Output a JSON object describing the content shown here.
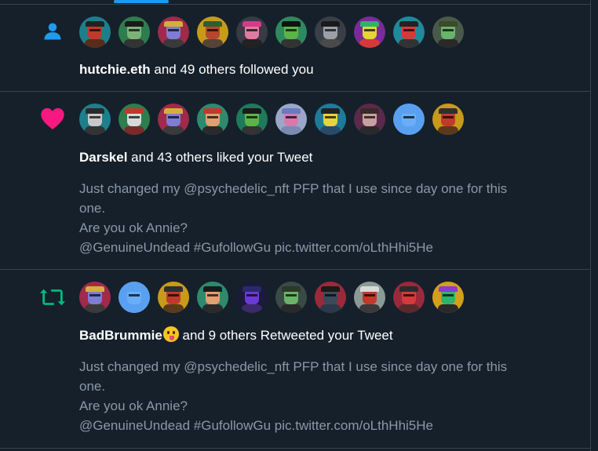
{
  "colors": {
    "background": "#15202b",
    "border": "#38444d",
    "accent_blue": "#1d9bf0",
    "like_pink": "#f91880",
    "retweet_green": "#00ba7c",
    "secondary_text": "#8b98a5"
  },
  "notifications": [
    {
      "type": "follow",
      "icon": "user-icon",
      "actor": "hutchie.eth",
      "rest": " and 49 others followed you",
      "avatars": [
        {
          "bg": "#1e7f8c",
          "skin": "#c0392b",
          "hat": "#222222",
          "body": "#5a2a1a"
        },
        {
          "bg": "#2e7d4f",
          "skin": "#7db37a",
          "hat": "#1a1a1a",
          "body": "#333333"
        },
        {
          "bg": "#a02a4a",
          "skin": "#7d7dd6",
          "hat": "#d4b03a",
          "body": "#3a3a3a"
        },
        {
          "bg": "#c89a1a",
          "skin": "#b5472f",
          "hat": "#2f5d2f",
          "body": "#554433"
        },
        {
          "bg": "#3a3a44",
          "skin": "#e07aa0",
          "hat": "#d63a8a",
          "body": "#222222"
        },
        {
          "bg": "#2e8a5e",
          "skin": "#5db34a",
          "hat": "#111111",
          "body": "#333333"
        },
        {
          "bg": "#3a3f47",
          "skin": "#9aa0a6",
          "hat": "#1a1a1a",
          "body": "#4a4a4a"
        },
        {
          "bg": "#7a2a9a",
          "skin": "#e6d43a",
          "hat": "#2fb36a",
          "body": "#d43a3a"
        },
        {
          "bg": "#1e8a9a",
          "skin": "#d43a3a",
          "hat": "#222222",
          "body": "#333333"
        },
        {
          "bg": "#4a5a4a",
          "skin": "#6ab36a",
          "hat": "#3a4a2a",
          "body": "#2a2a2a"
        }
      ]
    },
    {
      "type": "like",
      "icon": "heart-icon",
      "actor": "Darskel",
      "rest": " and 43 others liked your Tweet",
      "text_lines": [
        "Just changed my @psychedelic_nft PFP that I use since day one for this",
        "one.",
        "Are you ok Annie?",
        "@GenuineUndead #GufollowGu pic.twitter.com/oLthHhi5He"
      ],
      "avatars": [
        {
          "bg": "#1e7f8c",
          "skin": "#c8c8c8",
          "hat": "#2a2a2a",
          "body": "#333333"
        },
        {
          "bg": "#2e7d4f",
          "skin": "#d9d9d9",
          "hat": "#c0392b",
          "body": "#7a2a2a"
        },
        {
          "bg": "#a02a4a",
          "skin": "#7d7dd6",
          "hat": "#d4b03a",
          "body": "#3a3a3a"
        },
        {
          "bg": "#2e8a6e",
          "skin": "#e0a070",
          "hat": "#c0392b",
          "body": "#2a2a2a"
        },
        {
          "bg": "#1e7a5a",
          "skin": "#5db34a",
          "hat": "#1a1a1a",
          "body": "#333333"
        },
        {
          "bg": "#9aa7c8",
          "skin": "#d67ab0",
          "hat": "#6a7ac0",
          "body": "#7a8ab0"
        },
        {
          "bg": "#1e7a9a",
          "skin": "#e6d43a",
          "hat": "#222222",
          "body": "#2a4a6a"
        },
        {
          "bg": "#5a2a4a",
          "skin": "#c8a0a0",
          "hat": "#3a2a2a",
          "body": "#2a2a2a"
        },
        {
          "bg": "#5aa0f0",
          "skin": "#6aaef8",
          "hat": "#5aa0f0",
          "body": "#5aa0f0"
        },
        {
          "bg": "#c89a1a",
          "skin": "#c0392b",
          "hat": "#2f2f2f",
          "body": "#5a3a1a"
        }
      ]
    },
    {
      "type": "retweet",
      "icon": "retweet-icon",
      "actor": "BadBrummie",
      "rest": " and 9 others Retweeted your Tweet",
      "text_lines": [
        "Just changed my @psychedelic_nft PFP that I use since day one for this",
        "one.",
        "Are you ok Annie?",
        "@GenuineUndead #GufollowGu pic.twitter.com/oLthHhi5He"
      ],
      "avatars": [
        {
          "bg": "#a02a4a",
          "skin": "#7d7dd6",
          "hat": "#d4b03a",
          "body": "#3a3a3a"
        },
        {
          "bg": "#5aa0f0",
          "skin": "#6aaef8",
          "hat": "#5aa0f0",
          "body": "#5aa0f0"
        },
        {
          "bg": "#c89a1a",
          "skin": "#c0392b",
          "hat": "#2f2f2f",
          "body": "#5a3a1a"
        },
        {
          "bg": "#2e8a6e",
          "skin": "#e0a070",
          "hat": "#1a1a1a",
          "body": "#2a2a2a"
        },
        {
          "bg": "#1a1a3a",
          "skin": "#6a3ad6",
          "hat": "#2a2a6a",
          "body": "#3a2a6a"
        },
        {
          "bg": "#3a4a44",
          "skin": "#6ab36a",
          "hat": "#2a3a2a",
          "body": "#2a2a2a"
        },
        {
          "bg": "#9a2a3a",
          "skin": "#3a4a5a",
          "hat": "#1a1a1a",
          "body": "#2a3a4a"
        },
        {
          "bg": "#8a9a94",
          "skin": "#c0392b",
          "hat": "#d9d9d9",
          "body": "#3a3a3a"
        },
        {
          "bg": "#9a2a3a",
          "skin": "#d43a3a",
          "hat": "#2a2a2a",
          "body": "#5a2a2a"
        },
        {
          "bg": "#d4a01a",
          "skin": "#2fb36a",
          "hat": "#8a3ad6",
          "body": "#2a2a2a"
        }
      ]
    }
  ]
}
